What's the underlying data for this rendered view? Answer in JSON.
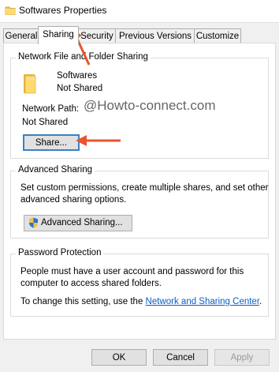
{
  "window": {
    "title": "Softwares Properties",
    "icon": "folder-icon"
  },
  "tabs": [
    {
      "label": "General",
      "active": false
    },
    {
      "label": "Sharing",
      "active": true
    },
    {
      "label": "Security",
      "active": false
    },
    {
      "label": "Previous Versions",
      "active": false
    },
    {
      "label": "Customize",
      "active": false
    }
  ],
  "network_sharing": {
    "title": "Network File and Folder Sharing",
    "folder_name": "Softwares",
    "folder_status": "Not Shared",
    "path_label": "Network Path:",
    "path_value": "Not Shared",
    "share_button": "Share..."
  },
  "watermark": "@Howto-connect.com",
  "advanced_sharing": {
    "title": "Advanced Sharing",
    "description_line1": "Set custom permissions, create multiple shares, and set other",
    "description_line2": "advanced sharing options.",
    "button": "Advanced Sharing...",
    "button_icon": "uac-shield-icon"
  },
  "password_protection": {
    "title": "Password Protection",
    "line1": "People must have a user account and password for this",
    "line2": "computer to access shared folders.",
    "change_prefix": "To change this setting, use the ",
    "link": "Network and Sharing Center",
    "change_suffix": "."
  },
  "footer": {
    "ok": "OK",
    "cancel": "Cancel",
    "apply": "Apply"
  },
  "colors": {
    "arrow": "#e8552e",
    "link": "#0a5ec8",
    "focus": "#3c7fc4"
  }
}
